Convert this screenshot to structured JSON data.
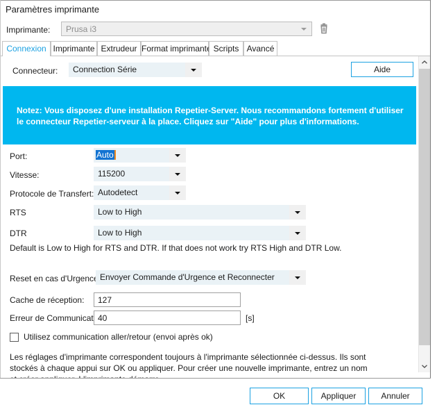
{
  "window": {
    "title": "Paramètres imprimante"
  },
  "printer": {
    "label": "Imprimante:",
    "selected": "Prusa i3",
    "delete_icon": "trash-icon"
  },
  "tabs": [
    {
      "label": "Connexion",
      "active": true
    },
    {
      "label": "Imprimante",
      "active": false
    },
    {
      "label": "Extrudeur",
      "active": false
    },
    {
      "label": "Format imprimante",
      "active": false
    },
    {
      "label": "Scripts",
      "active": false
    },
    {
      "label": "Avancé",
      "active": false
    }
  ],
  "connector": {
    "label": "Connecteur:",
    "value": "Connection Série"
  },
  "help_button": {
    "label": "Aide"
  },
  "notice": {
    "text": "Notez: Vous disposez d'une installation Repetier-Server. Nous recommandons fortement d'utiliser le connecteur Repetier-serveur à la place. Cliquez sur \"Aide\" pour plus d'informations.",
    "background": "#00b7ef",
    "color": "#ffffff"
  },
  "fields": {
    "port": {
      "label": "Port:",
      "value": "Auto",
      "selected": true
    },
    "vitesse": {
      "label": "Vitesse:",
      "value": "115200"
    },
    "protocole": {
      "label": "Protocole de Transfert:",
      "value": "Autodetect"
    },
    "rts": {
      "label": "RTS",
      "value": "Low to High"
    },
    "dtr": {
      "label": "DTR",
      "value": "Low to High"
    },
    "hint": "Default is Low to High for RTS and DTR. If that does not work try RTS High and DTR Low.",
    "reset_urgence": {
      "label": "Reset en cas d'Urgence",
      "value": "Envoyer Commande d'Urgence et Reconnecter"
    },
    "cache_reception": {
      "label": "Cache de réception:",
      "value": "127"
    },
    "erreur_comm": {
      "label": "Erreur de Communication:",
      "value": "40",
      "unit": "[s]"
    },
    "checkbox": {
      "label": "Utilisez communication aller/retour (envoi après ok)",
      "checked": false
    }
  },
  "footer_paragraph": "Les réglages d'imprimante correspondent toujours à l'imprimante sélectionnée ci-dessus. Ils sont stockés à chaque appui sur OK ou appliquer. Pour créer une nouvelle imprimante, entrez un nom et créer appliquer. L'imprimante démarre",
  "scrollbar": {
    "up_icon": "chevron-up-icon",
    "down_icon": "chevron-down-icon"
  },
  "buttons": {
    "ok": "OK",
    "apply": "Appliquer",
    "cancel": "Annuler"
  },
  "colors": {
    "accent": "#1ba1e2",
    "notice_bg": "#00b7ef",
    "field_bg": "#eaf2f6",
    "selection": "#1273d2"
  }
}
